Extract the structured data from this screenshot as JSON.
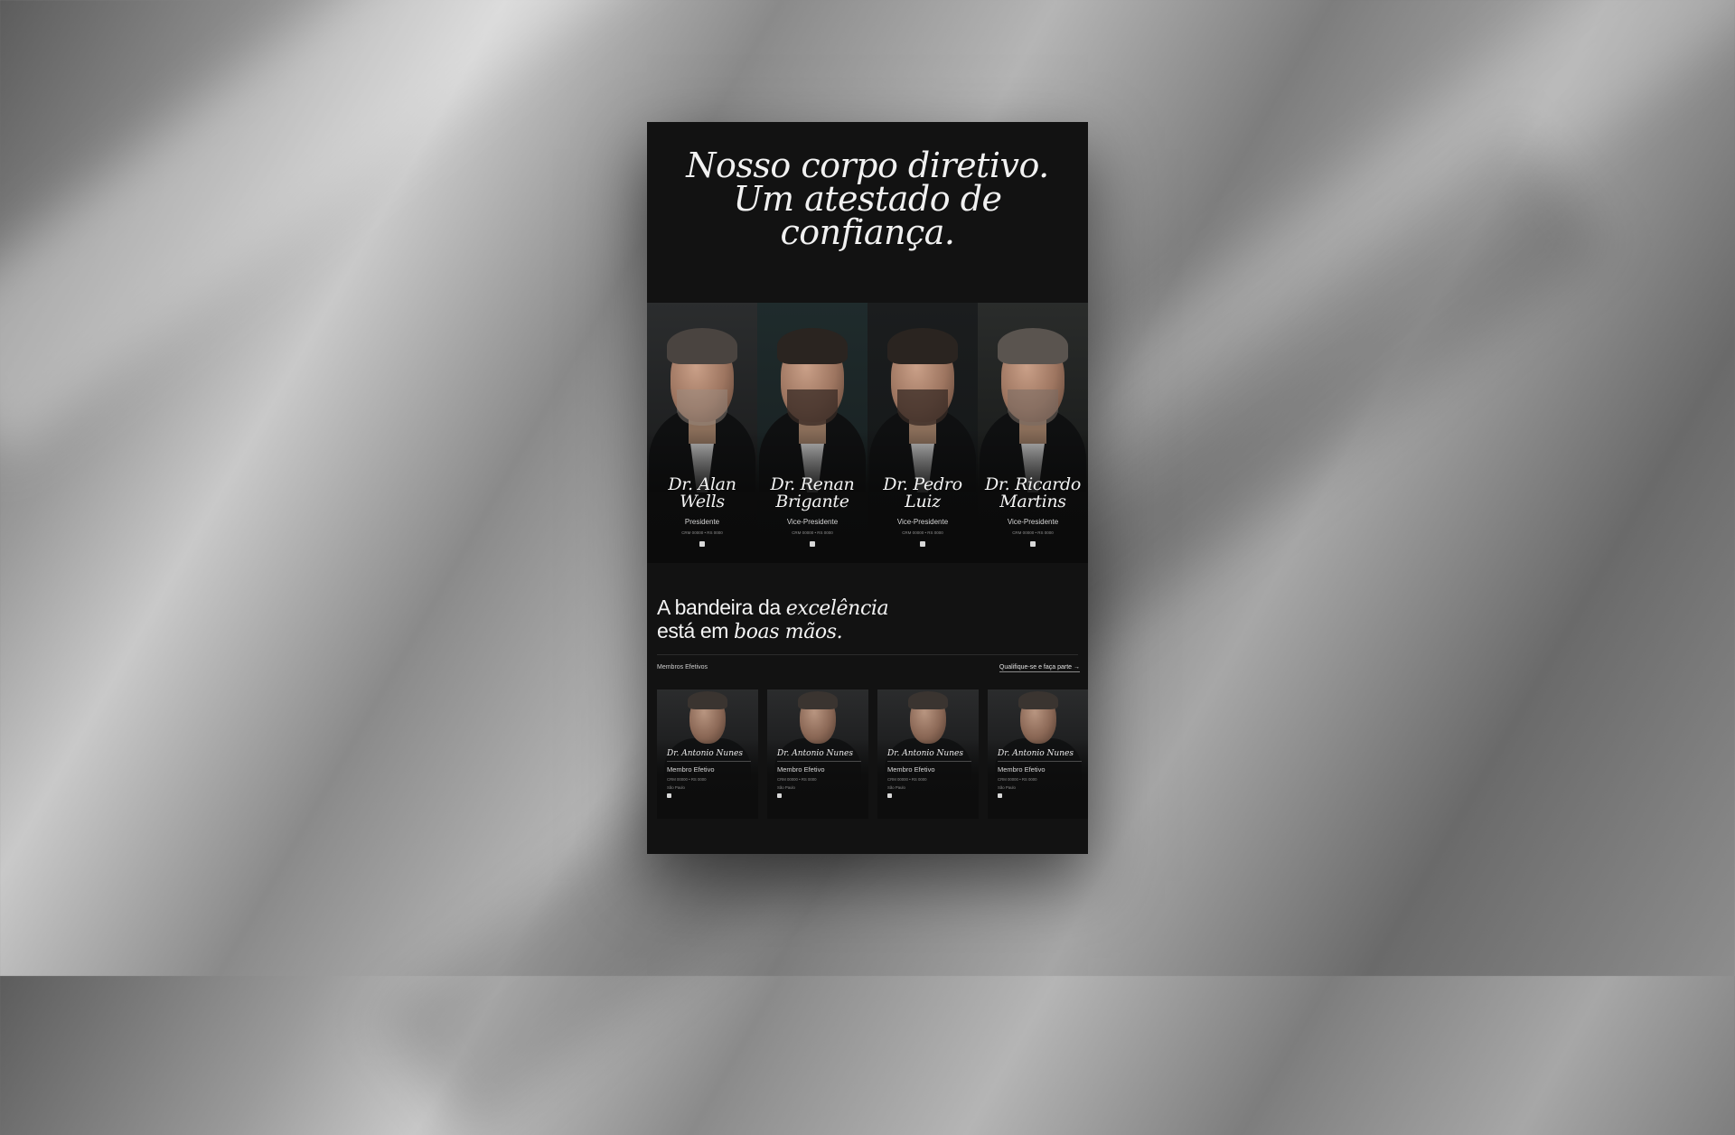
{
  "hero": {
    "title_lines": [
      "Nosso corpo diretivo.",
      "Um atestado de",
      "confiança."
    ]
  },
  "board": [
    {
      "name_line1": "Dr. Alan",
      "name_line2": "Wells",
      "role": "Presidente",
      "reg": "CRM 00000 • RS 0000",
      "icon": "linkedin-icon"
    },
    {
      "name_line1": "Dr. Renan",
      "name_line2": "Brigante",
      "role": "Vice-Presidente",
      "reg": "CRM 00000 • RS 0000",
      "icon": "linkedin-icon"
    },
    {
      "name_line1": "Dr. Pedro",
      "name_line2": "Luiz",
      "role": "Vice-Presidente",
      "reg": "CRM 00000 • RS 0000",
      "icon": "linkedin-icon"
    },
    {
      "name_line1": "Dr. Ricardo",
      "name_line2": "Martins",
      "role": "Vice-Presidente",
      "reg": "CRM 00000 • RS 0000",
      "icon": "linkedin-icon"
    }
  ],
  "excellence": {
    "line1_plain": "A bandeira da ",
    "line1_italic": "excelência",
    "line2_plain": "está em ",
    "line2_italic": "boas mãos."
  },
  "members_section": {
    "label": "Membros Efetivos",
    "link_label": "Qualifique-se e faça parte →"
  },
  "members": [
    {
      "name": "Dr. Antonio Nunes",
      "role": "Membro Efetivo",
      "reg": "CRM 00000 • RS 0000",
      "city": "São Paulo",
      "icon": "linkedin-icon"
    },
    {
      "name": "Dr. Antonio Nunes",
      "role": "Membro Efetivo",
      "reg": "CRM 00000 • RS 0000",
      "city": "São Paulo",
      "icon": "linkedin-icon"
    },
    {
      "name": "Dr. Antonio Nunes",
      "role": "Membro Efetivo",
      "reg": "CRM 00000 • RS 0000",
      "city": "São Paulo",
      "icon": "linkedin-icon"
    },
    {
      "name": "Dr. Antonio Nunes",
      "role": "Membro Efetivo",
      "reg": "CRM 00000 • RS 0000",
      "city": "São Paulo",
      "icon": "linkedin-icon"
    }
  ],
  "colors": {
    "page_background": "#121212",
    "text_primary": "#f1f1f1",
    "text_muted": "#8e8e8e"
  }
}
